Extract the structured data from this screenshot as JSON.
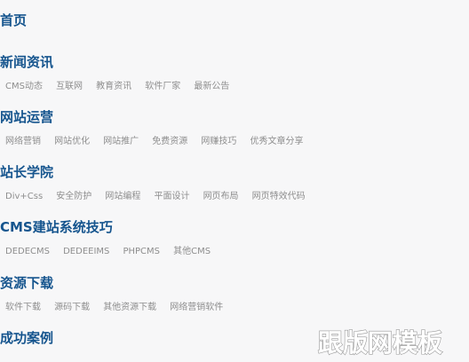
{
  "sections": [
    {
      "title": "首页",
      "subs": []
    },
    {
      "title": "新闻资讯",
      "subs": [
        "CMS动态",
        "互联网",
        "教育资讯",
        "软件厂家",
        "最新公告"
      ]
    },
    {
      "title": "网站运营",
      "subs": [
        "网络营销",
        "网站优化",
        "网站推广",
        "免费资源",
        "网赚技巧",
        "优秀文章分享"
      ]
    },
    {
      "title": "站长学院",
      "subs": [
        "Div+Css",
        "安全防护",
        "网站编程",
        "平面设计",
        "网页布局",
        "网页特效代码"
      ]
    },
    {
      "title": "CMS建站系统技巧",
      "subs": [
        "DEDECMS",
        "DEDEEIMS",
        "PHPCMS",
        "其他CMS"
      ]
    },
    {
      "title": "资源下载",
      "subs": [
        "软件下载",
        "源码下载",
        "其他资源下载",
        "网络营销软件"
      ]
    },
    {
      "title": "成功案例",
      "subs": []
    }
  ],
  "watermark": {
    "text": "跟版网模板",
    "color": "#ffffff"
  }
}
